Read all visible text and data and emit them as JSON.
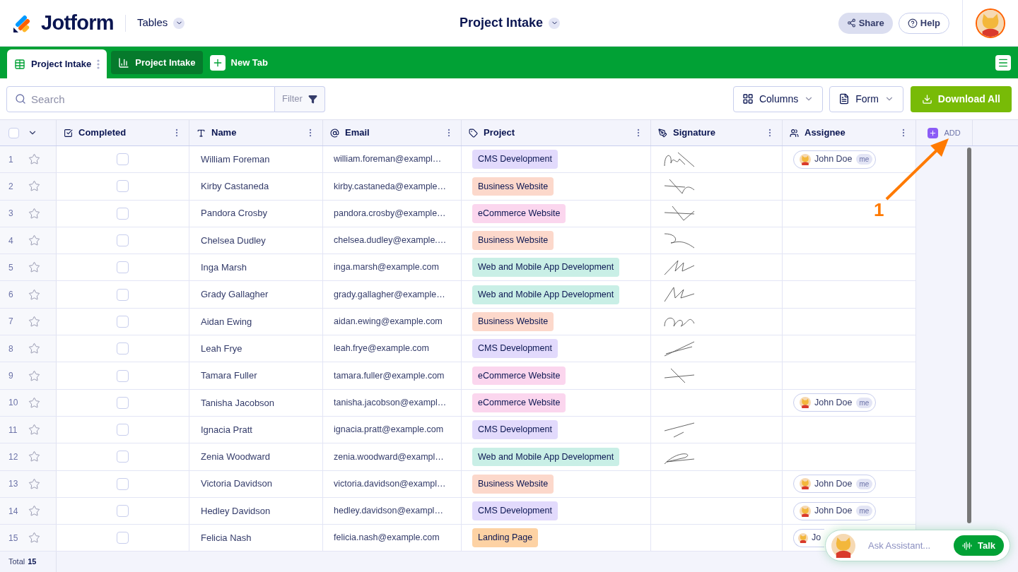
{
  "header": {
    "brand": "Jotform",
    "section": "Tables",
    "title": "Project Intake",
    "share": "Share",
    "help": "Help"
  },
  "tabs": [
    {
      "label": "Project Intake",
      "kind": "grid",
      "selected": true
    },
    {
      "label": "Project Intake",
      "kind": "report",
      "selected": false
    }
  ],
  "new_tab": "New Tab",
  "toolbar": {
    "search_placeholder": "Search",
    "filter": "Filter",
    "columns": "Columns",
    "form": "Form",
    "download": "Download All"
  },
  "table": {
    "select_all": {
      "checked": false
    },
    "columns": [
      {
        "label": "Completed",
        "kind": "check"
      },
      {
        "label": "Name",
        "kind": "text"
      },
      {
        "label": "Email",
        "kind": "email"
      },
      {
        "label": "Project",
        "kind": "tag"
      },
      {
        "label": "Signature",
        "kind": "signature"
      },
      {
        "label": "Assignee",
        "kind": "person"
      }
    ],
    "add": "ADD",
    "rows": [
      {
        "num": "1",
        "starred": false,
        "checked": false,
        "name": "William Foreman",
        "email": "william.foreman@exampl…",
        "project": "CMS Development",
        "color": "#e2dafc",
        "signed": true,
        "assignee": "John Doe",
        "me": "me"
      },
      {
        "num": "2",
        "starred": false,
        "checked": false,
        "name": "Kirby Castaneda",
        "email": "kirby.castaneda@example…",
        "project": "Business Website",
        "color": "#fcd8cb",
        "signed": true
      },
      {
        "num": "3",
        "starred": false,
        "checked": false,
        "name": "Pandora Crosby",
        "email": "pandora.crosby@example…",
        "project": "eCommerce Website",
        "color": "#fbd6ee",
        "signed": true
      },
      {
        "num": "4",
        "starred": false,
        "checked": false,
        "name": "Chelsea Dudley",
        "email": "chelsea.dudley@example.…",
        "project": "Business Website",
        "color": "#fcd8cb",
        "signed": true
      },
      {
        "num": "5",
        "starred": false,
        "checked": false,
        "name": "Inga Marsh",
        "email": "inga.marsh@example.com",
        "project": "Web and Mobile App Development",
        "color": "#c9efe6",
        "signed": true
      },
      {
        "num": "6",
        "starred": false,
        "checked": false,
        "name": "Grady Gallagher",
        "email": "grady.gallagher@example…",
        "project": "Web and Mobile App Development",
        "color": "#c9efe6",
        "signed": true
      },
      {
        "num": "7",
        "starred": false,
        "checked": false,
        "name": "Aidan Ewing",
        "email": "aidan.ewing@example.com",
        "project": "Business Website",
        "color": "#fcd8cb",
        "signed": true
      },
      {
        "num": "8",
        "starred": false,
        "checked": false,
        "name": "Leah Frye",
        "email": "leah.frye@example.com",
        "project": "CMS Development",
        "color": "#e2dafc",
        "signed": true
      },
      {
        "num": "9",
        "starred": false,
        "checked": false,
        "name": "Tamara Fuller",
        "email": "tamara.fuller@example.com",
        "project": "eCommerce Website",
        "color": "#fbd6ee",
        "signed": true
      },
      {
        "num": "10",
        "starred": false,
        "checked": false,
        "name": "Tanisha Jacobson",
        "email": "tanisha.jacobson@exampl…",
        "project": "eCommerce Website",
        "color": "#fbd6ee",
        "signed": false,
        "assignee": "John Doe",
        "me": "me"
      },
      {
        "num": "11",
        "starred": false,
        "checked": false,
        "name": "Ignacia Pratt",
        "email": "ignacia.pratt@example.com",
        "project": "CMS Development",
        "color": "#e2dafc",
        "signed": true
      },
      {
        "num": "12",
        "starred": false,
        "checked": false,
        "name": "Zenia Woodward",
        "email": "zenia.woodward@exampl…",
        "project": "Web and Mobile App Development",
        "color": "#c9efe6",
        "signed": true
      },
      {
        "num": "13",
        "starred": false,
        "checked": false,
        "name": "Victoria Davidson",
        "email": "victoria.davidson@exampl…",
        "project": "Business Website",
        "color": "#fcd8cb",
        "signed": false,
        "assignee": "John Doe",
        "me": "me"
      },
      {
        "num": "14",
        "starred": false,
        "checked": false,
        "name": "Hedley Davidson",
        "email": "hedley.davidson@exampl…",
        "project": "CMS Development",
        "color": "#e2dafc",
        "signed": false,
        "assignee": "John Doe",
        "me": "me"
      },
      {
        "num": "15",
        "starred": false,
        "checked": false,
        "name": "Felicia Nash",
        "email": "felicia.nash@example.com",
        "project": "Landing Page",
        "color": "#fdd2a4",
        "signed": false,
        "assignee": "Jo",
        "cut": true
      }
    ]
  },
  "footer": {
    "label": "Total",
    "count": "15"
  },
  "annotation": "1",
  "assistant": {
    "placeholder": "Ask Assistant...",
    "talk": "Talk"
  }
}
